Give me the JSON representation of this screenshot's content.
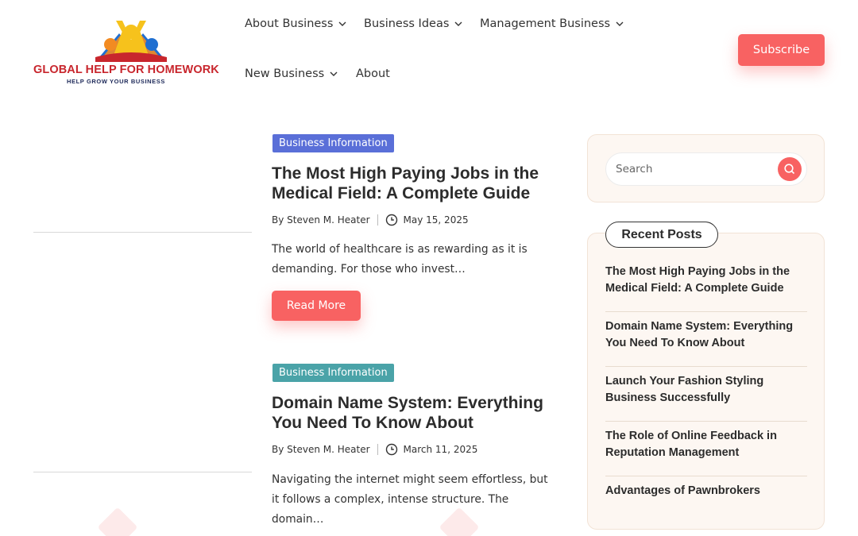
{
  "brand": {
    "title": "GLOBAL HELP FOR HOMEWORK",
    "tagline": "HELP GROW YOUR BUSINESS",
    "colors": {
      "red": "#c8262d",
      "navy": "#1e2a5a",
      "orange": "#f28b22",
      "yellow": "#f6c21c",
      "blue": "#1f6fd1"
    }
  },
  "nav": {
    "items": [
      {
        "label": "About Business",
        "has_dropdown": true
      },
      {
        "label": "Business Ideas",
        "has_dropdown": true
      },
      {
        "label": "Management Business",
        "has_dropdown": true
      },
      {
        "label": "New Business",
        "has_dropdown": true
      },
      {
        "label": "About",
        "has_dropdown": false
      }
    ],
    "subscribe_label": "Subscribe"
  },
  "posts": [
    {
      "category": "Business Information",
      "category_color": "#5a6fd8",
      "title": "The Most High Paying Jobs in the Medical Field: A Complete Guide",
      "author": "By Steven M. Heater",
      "date": "May 15, 2025",
      "excerpt": "The world of healthcare is as rewarding as it is demanding. For those who invest…",
      "read_more": "Read More"
    },
    {
      "category": "Business Information",
      "category_color": "#4aa3a8",
      "title": "Domain Name System: Everything You Need To Know About",
      "author": "By Steven M. Heater",
      "date": "March 11, 2025",
      "excerpt": "Navigating the internet might seem effortless, but it follows a complex, intense structure. The domain…"
    }
  ],
  "sidebar": {
    "search_placeholder": "Search",
    "recent_heading": "Recent Posts",
    "recent_posts": [
      "The Most High Paying Jobs in the Medical Field: A Complete Guide",
      "Domain Name System: Everything You Need To Know About",
      "Launch Your Fashion Styling Business Successfully",
      "The Role of Online Feedback in Reputation Management",
      "Advantages of Pawnbrokers"
    ]
  },
  "accent_color": "#f86262"
}
